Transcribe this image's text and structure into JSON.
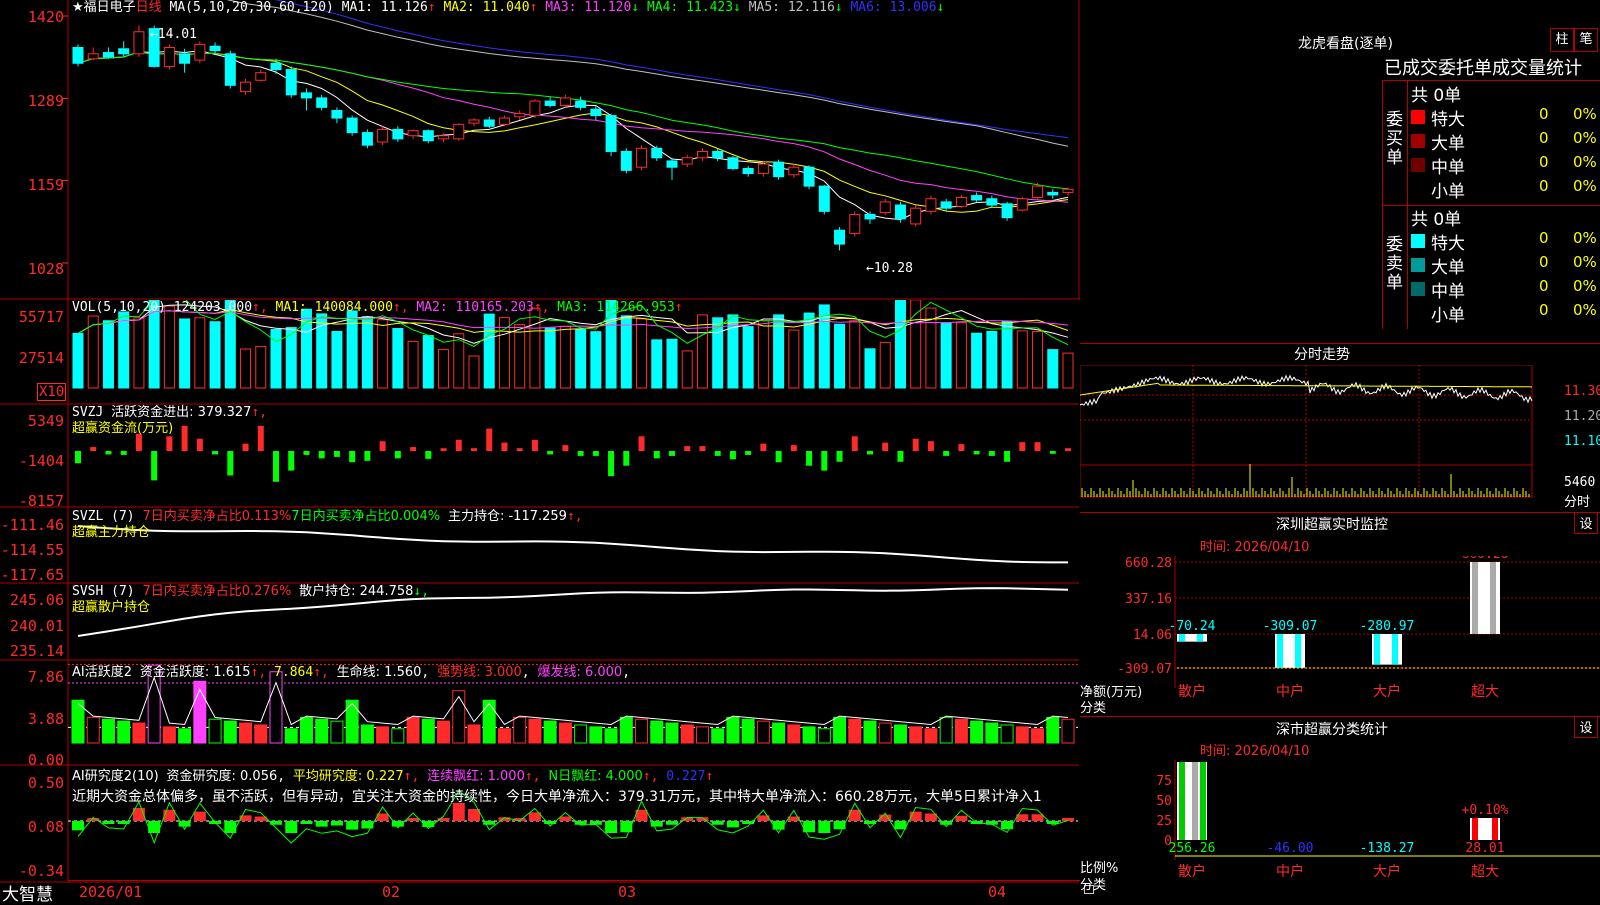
{
  "colors": {
    "up": "#ff2a2a",
    "down": "#00ffff",
    "green": "#00ff00",
    "frame": "#b00000",
    "white": "#ffffff",
    "yellow": "#ffff00",
    "magenta": "#ff40ff",
    "blue": "#2020ff",
    "gray": "#b0b0b0"
  },
  "main": {
    "title": "★福日电子",
    "period": "日线",
    "ma_text": "MA(5,10,20,30,60,120)",
    "ma_values": [
      {
        "label": "MA1: 11.126",
        "arrow": "↑",
        "color": "#ffffff",
        "acolor": "#ff2a2a"
      },
      {
        "label": "MA2: 11.040",
        "arrow": "↑",
        "color": "#ffff00",
        "acolor": "#ff2a2a"
      },
      {
        "label": "MA3: 11.120",
        "arrow": "↓",
        "color": "#ff40ff",
        "acolor": "#00ff00"
      },
      {
        "label": "MA4: 11.423",
        "arrow": "↓",
        "color": "#00ff00",
        "acolor": "#00ff00"
      },
      {
        "label": "MA5: 12.116",
        "arrow": "↓",
        "color": "#c0c0c0",
        "acolor": "#00ff00"
      },
      {
        "label": "MA6: 13.006",
        "arrow": "↓",
        "color": "#3030ff",
        "acolor": "#00ff00"
      }
    ],
    "y_ticks": [
      "1420",
      "1289",
      "1159",
      "1028"
    ],
    "high_label": "←14.01",
    "low_label": "←10.28"
  },
  "vol": {
    "header": "VOL(5,10,20)",
    "value": "124203.000",
    "ma1": "MA1: 140084.000",
    "ma2": "MA2: 110165.203",
    "ma3": "MA3: 114266.953",
    "y_ticks": [
      "55717",
      "27514"
    ],
    "unit": "X10"
  },
  "svzj": {
    "header": "SVZJ",
    "label": "活跃资金进出: 379.327",
    "subtitle": "超赢资金流(万元)",
    "y_ticks": [
      "5349",
      "-1404",
      "-8157"
    ]
  },
  "svzl": {
    "header": "SVZL (7)",
    "t1": "7日内买卖净占比0.113%",
    "t2": "7日内买卖净占比0.004%",
    "t3": "主力持仓: -117.259",
    "subtitle": "超赢主力持仓",
    "y_ticks": [
      "-111.46",
      "-114.55",
      "-117.65"
    ]
  },
  "svsh": {
    "header": "SVSH (7)",
    "t1": "7日内买卖净占比0.276%",
    "t2": "散户持仓: 244.758",
    "subtitle": "超赢散户持仓",
    "y_ticks": [
      "245.06",
      "240.01",
      "235.14"
    ]
  },
  "ai1": {
    "header": "AI活跃度2",
    "t1": "资金活跃度: 1.615",
    "t2": "7.864",
    "t3": "生命线: 1.560",
    "t4": "强势线: 3.000",
    "t5": "爆发线: 6.000",
    "y_ticks": [
      "7.86",
      "3.88",
      "0.00"
    ]
  },
  "ai2": {
    "header": "AI研究度2(10)",
    "t1": "资金研究度: 0.056",
    "t2": "平均研究度: 0.227",
    "t3": "连续飘红: 1.000",
    "t4": "N日飘红: 4.000",
    "t5": "0.227",
    "comment": "近期大资金总体偏多，虽不活跃，但有异动，宜关注大资金的持续性，今日大单净流入：379.31万元，其中特大单净流入：660.28万元，大单5日累计净入1",
    "y_ticks": [
      "0.50",
      "0.08",
      "-0.34"
    ]
  },
  "x_axis": {
    "labels": [
      "2026/01",
      "02",
      "03",
      "04"
    ],
    "brand": "大智慧"
  },
  "right": {
    "dragon_title": "龙虎看盘(逐单)",
    "btn1": "柱",
    "btn2": "笔",
    "stats_title": "已成交委托单成交量统计",
    "buy_side": "委买单",
    "sell_side": "委卖单",
    "buy_total": "共 0单",
    "sell_total": "共 0单",
    "buy_rows": [
      {
        "name": "特大",
        "v": "0",
        "p": "0%",
        "c": "#ff0000"
      },
      {
        "name": "大单",
        "v": "0",
        "p": "0%",
        "c": "#a00000"
      },
      {
        "name": "中单",
        "v": "0",
        "p": "0%",
        "c": "#700000"
      },
      {
        "name": "小单",
        "v": "0",
        "p": "0%",
        "c": "#000000"
      }
    ],
    "sell_rows": [
      {
        "name": "特大",
        "v": "0",
        "p": "0%",
        "c": "#00ffff"
      },
      {
        "name": "大单",
        "v": "0",
        "p": "0%",
        "c": "#009a9a"
      },
      {
        "name": "中单",
        "v": "0",
        "p": "0%",
        "c": "#006a6a"
      },
      {
        "name": "小单",
        "v": "0",
        "p": "0%",
        "c": "#000000"
      }
    ],
    "intraday_title": "分时走势",
    "intraday_ticks": [
      "11.30",
      "11.20",
      "11.10"
    ],
    "intraday_vol": "5460",
    "intraday_unit": "分时",
    "sz_title": "深圳超赢实时监控",
    "sz_btn": "设",
    "sz_time": "时间: 2026/04/10",
    "sz_y": [
      "660.28",
      "337.16",
      "14.06",
      "-309.07"
    ],
    "sz_bars": [
      {
        "label": "-70.24",
        "v": -70.24
      },
      {
        "label": "-309.07",
        "v": -309.07
      },
      {
        "label": "-280.97",
        "v": -280.97
      },
      {
        "label": "660.28",
        "v": 660.28
      }
    ],
    "sz_unit": "净额(万元)",
    "cat_label": "分类",
    "categories": [
      "散户",
      "中户",
      "大户",
      "超大"
    ],
    "sh_title": "深市超赢分类统计",
    "sh_btn": "设",
    "sh_time": "时间: 2026/04/10",
    "sh_y": [
      "75",
      "50",
      "25",
      "0"
    ],
    "sh_pct": "+0.10%",
    "sh_vals": [
      "256.26",
      "-46.00",
      "-138.27",
      "28.01"
    ],
    "sh_unit": "比例%"
  },
  "chart_data": {
    "type": "candlestick",
    "ylim": [
      1028,
      1420
    ],
    "candles": [
      [
        1370,
        1345,
        1375,
        1340
      ],
      [
        1352,
        1360,
        1370,
        1350
      ],
      [
        1362,
        1355,
        1370,
        1352
      ],
      [
        1368,
        1360,
        1380,
        1355
      ],
      [
        1360,
        1395,
        1405,
        1355
      ],
      [
        1400,
        1340,
        1405,
        1338
      ],
      [
        1340,
        1370,
        1375,
        1335
      ],
      [
        1360,
        1345,
        1368,
        1330
      ],
      [
        1350,
        1375,
        1380,
        1345
      ],
      [
        1372,
        1365,
        1378,
        1360
      ],
      [
        1360,
        1310,
        1365,
        1305
      ],
      [
        1300,
        1315,
        1320,
        1295
      ],
      [
        1318,
        1330,
        1335,
        1316
      ],
      [
        1345,
        1335,
        1352,
        1328
      ],
      [
        1335,
        1295,
        1340,
        1290
      ],
      [
        1298,
        1290,
        1305,
        1270
      ],
      [
        1290,
        1275,
        1295,
        1270
      ],
      [
        1270,
        1258,
        1275,
        1250
      ],
      [
        1258,
        1235,
        1262,
        1230
      ],
      [
        1235,
        1215,
        1240,
        1210
      ],
      [
        1220,
        1240,
        1245,
        1215
      ],
      [
        1240,
        1225,
        1245,
        1220
      ],
      [
        1230,
        1238,
        1240,
        1225
      ],
      [
        1238,
        1222,
        1240,
        1218
      ],
      [
        1225,
        1230,
        1234,
        1220
      ],
      [
        1225,
        1248,
        1250,
        1222
      ],
      [
        1250,
        1255,
        1258,
        1245
      ],
      [
        1255,
        1245,
        1260,
        1242
      ],
      [
        1248,
        1258,
        1262,
        1245
      ],
      [
        1260,
        1265,
        1270,
        1255
      ],
      [
        1262,
        1285,
        1288,
        1258
      ],
      [
        1285,
        1278,
        1292,
        1275
      ],
      [
        1278,
        1290,
        1295,
        1275
      ],
      [
        1285,
        1275,
        1292,
        1270
      ],
      [
        1272,
        1262,
        1278,
        1255
      ],
      [
        1262,
        1205,
        1265,
        1198
      ],
      [
        1205,
        1175,
        1210,
        1170
      ],
      [
        1180,
        1210,
        1215,
        1175
      ],
      [
        1210,
        1195,
        1214,
        1190
      ],
      [
        1190,
        1180,
        1195,
        1160
      ],
      [
        1185,
        1195,
        1200,
        1180
      ],
      [
        1195,
        1205,
        1210,
        1190
      ],
      [
        1205,
        1195,
        1210,
        1190
      ],
      [
        1195,
        1178,
        1198,
        1175
      ],
      [
        1178,
        1170,
        1182,
        1165
      ],
      [
        1170,
        1185,
        1190,
        1165
      ],
      [
        1188,
        1165,
        1192,
        1160
      ],
      [
        1168,
        1180,
        1185,
        1163
      ],
      [
        1180,
        1150,
        1183,
        1145
      ],
      [
        1150,
        1110,
        1152,
        1105
      ],
      [
        1080,
        1058,
        1085,
        1048
      ],
      [
        1075,
        1105,
        1110,
        1070
      ],
      [
        1105,
        1098,
        1110,
        1090
      ],
      [
        1108,
        1125,
        1130,
        1104
      ],
      [
        1120,
        1098,
        1125,
        1092
      ],
      [
        1090,
        1115,
        1120,
        1086
      ],
      [
        1110,
        1130,
        1135,
        1105
      ],
      [
        1125,
        1115,
        1130,
        1110
      ],
      [
        1118,
        1132,
        1136,
        1115
      ],
      [
        1135,
        1128,
        1140,
        1125
      ],
      [
        1130,
        1120,
        1135,
        1115
      ],
      [
        1122,
        1100,
        1125,
        1095
      ],
      [
        1112,
        1130,
        1133,
        1110
      ],
      [
        1132,
        1150,
        1155,
        1128
      ],
      [
        1140,
        1136,
        1145,
        1130
      ],
      [
        1140,
        1145,
        1148,
        1135
      ]
    ]
  }
}
